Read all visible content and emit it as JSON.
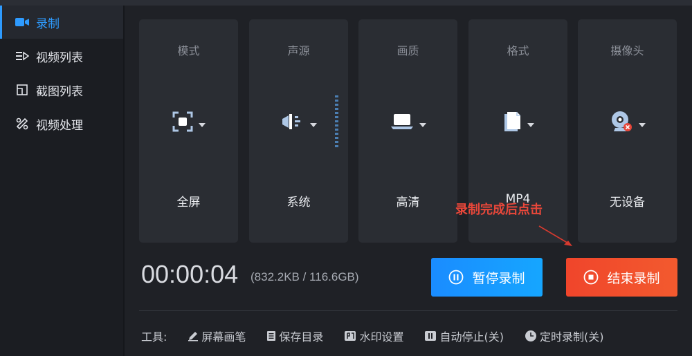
{
  "sidebar": {
    "items": [
      {
        "label": "录制",
        "icon": "video-camera-icon",
        "active": true
      },
      {
        "label": "视频列表",
        "icon": "video-list-icon"
      },
      {
        "label": "截图列表",
        "icon": "screenshot-list-icon"
      },
      {
        "label": "视频处理",
        "icon": "video-tools-icon"
      }
    ]
  },
  "cards": [
    {
      "title": "模式",
      "value": "全屏",
      "icon": "fullscreen-icon"
    },
    {
      "title": "声源",
      "value": "系统",
      "icon": "speaker-icon"
    },
    {
      "title": "画质",
      "value": "高清",
      "icon": "laptop-icon"
    },
    {
      "title": "格式",
      "value": "MP4",
      "icon": "file-icon"
    },
    {
      "title": "摄像头",
      "value": "无设备",
      "icon": "webcam-icon"
    }
  ],
  "status": {
    "timer": "00:00:04",
    "size": "(832.2KB / 116.6GB)"
  },
  "buttons": {
    "pause": "暂停录制",
    "stop": "结束录制"
  },
  "annotation": "录制完成后点击",
  "tools": {
    "label": "工具:",
    "items": [
      {
        "label": "屏幕画笔",
        "icon": "pen-icon"
      },
      {
        "label": "保存目录",
        "icon": "document-icon"
      },
      {
        "label": "水印设置",
        "icon": "watermark-icon"
      },
      {
        "label": "自动停止(关)",
        "icon": "pause-square-icon"
      },
      {
        "label": "定时录制(关)",
        "icon": "clock-icon"
      }
    ]
  },
  "colors": {
    "accent": "#2e9bff",
    "stop": "#f0452b",
    "background": "#1f2126",
    "card": "#2a2d33"
  }
}
